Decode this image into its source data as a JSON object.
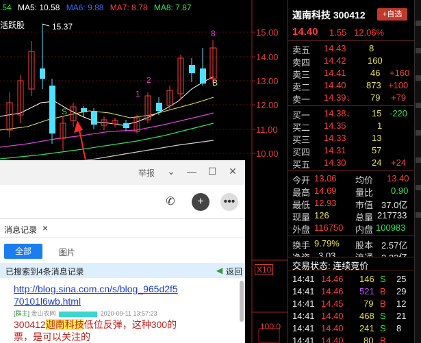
{
  "ma_bar": {
    "partial_first": ".54",
    "ma5": "MA5: 10.58",
    "ma6": "MA6: 9.88",
    "ma7": "MA7: 8.78",
    "ma8": "MA8: 7.87",
    "colors": {
      "ma5": "#ffffff",
      "ma6": "#3b6cff",
      "ma7": "#ff3b3b",
      "ma8": "#2fe35b"
    }
  },
  "chart": {
    "label_active": "活跃股",
    "high_mark": "15.37",
    "wave_labels": [
      "1",
      "2",
      "S",
      "B",
      "8"
    ],
    "axis_ticks": [
      "15.00",
      "14.00",
      "13.00",
      "12.00",
      "11.00",
      "10.00"
    ],
    "volume_ticks": [
      "100.0"
    ],
    "x10": "X10"
  },
  "quote": {
    "stock_name": "迦南科技 300412",
    "watch_button": "+自选",
    "price": "14.40",
    "change": "1.55",
    "change_pct": "12.06%",
    "sell": [
      {
        "label": "卖五",
        "price": "14.43",
        "vol": "8",
        "chg": ""
      },
      {
        "label": "卖四",
        "price": "14.42",
        "vol": "160",
        "chg": ""
      },
      {
        "label": "卖三",
        "price": "14.41",
        "vol": "46",
        "chg": "+160"
      },
      {
        "label": "卖二",
        "price": "14.40",
        "vol": "873",
        "chg": "+100"
      },
      {
        "label": "卖一",
        "price": "14.39↓",
        "vol": "79",
        "chg": "+79"
      }
    ],
    "buy": [
      {
        "label": "买一",
        "price": "14.38↓",
        "vol": "15",
        "chg": "-220"
      },
      {
        "label": "买二",
        "price": "14.35",
        "vol": "1",
        "chg": ""
      },
      {
        "label": "买三",
        "price": "14.33",
        "vol": "13",
        "chg": ""
      },
      {
        "label": "买四",
        "price": "14.31",
        "vol": "57",
        "chg": ""
      },
      {
        "label": "买五",
        "price": "14.30",
        "vol": "24",
        "chg": "+24"
      }
    ],
    "stats": [
      {
        "l1": "今开",
        "v1": "13.06",
        "l2": "均价",
        "v2": "13.40"
      },
      {
        "l1": "最高",
        "v1": "14.69",
        "l2": "量比",
        "v2": "0.90"
      },
      {
        "l1": "最低",
        "v1": "12.93",
        "l2": "市值",
        "v2": "37.0亿"
      },
      {
        "l1": "现量",
        "v1": "126",
        "l2": "总量",
        "v2": "217733"
      },
      {
        "l1": "外盘",
        "v1": "116750",
        "l2": "内盘",
        "v2": "100983"
      }
    ],
    "stats2": [
      {
        "l1": "换手",
        "v1": "9.79%",
        "l2": "股本",
        "v2": "2.57亿"
      },
      {
        "l1": "净资",
        "v1": "3.03",
        "l2": "流通",
        "v2": "2.23亿"
      }
    ],
    "trade_status": "交易状态: 连续竞价",
    "ticks": [
      {
        "t": "14:41",
        "p": "14.46",
        "v": "146",
        "s": "S"
      },
      {
        "t": "14:41",
        "p": "14.46",
        "v": "521",
        "s": "B"
      },
      {
        "t": "14:41",
        "p": "14.45",
        "v": "79",
        "s": "B"
      },
      {
        "t": "14:41",
        "p": "14.40",
        "v": "468",
        "s": "S"
      },
      {
        "t": "14:41",
        "p": "14.40",
        "v": "241",
        "s": "S"
      },
      {
        "t": "14:41",
        "p": "14.40",
        "v": "80",
        "s": "B"
      }
    ],
    "tick_extra": [
      "25",
      "29",
      "12",
      "21",
      "8",
      ""
    ]
  },
  "chat": {
    "report": "举报",
    "tab_records": "消息记录",
    "tab_close": "×",
    "btn_all": "全部",
    "btn_images": "图片",
    "search_result": "已搜索到4条消息记录",
    "back": "返回",
    "link_line1": "http://blog.sina.com.cn/s/blog_965d2f5",
    "link_line2": "70101l6wb.html",
    "meta_group": "[群主]",
    "meta_name": "金山农网",
    "meta_time": "2020-09-11 13:57:23",
    "msg_prefix": "300412",
    "msg_highlight": "迦南科技",
    "msg_rest": "低位反弹，这种300的",
    "msg_line2": "票，是可以关注的"
  }
}
